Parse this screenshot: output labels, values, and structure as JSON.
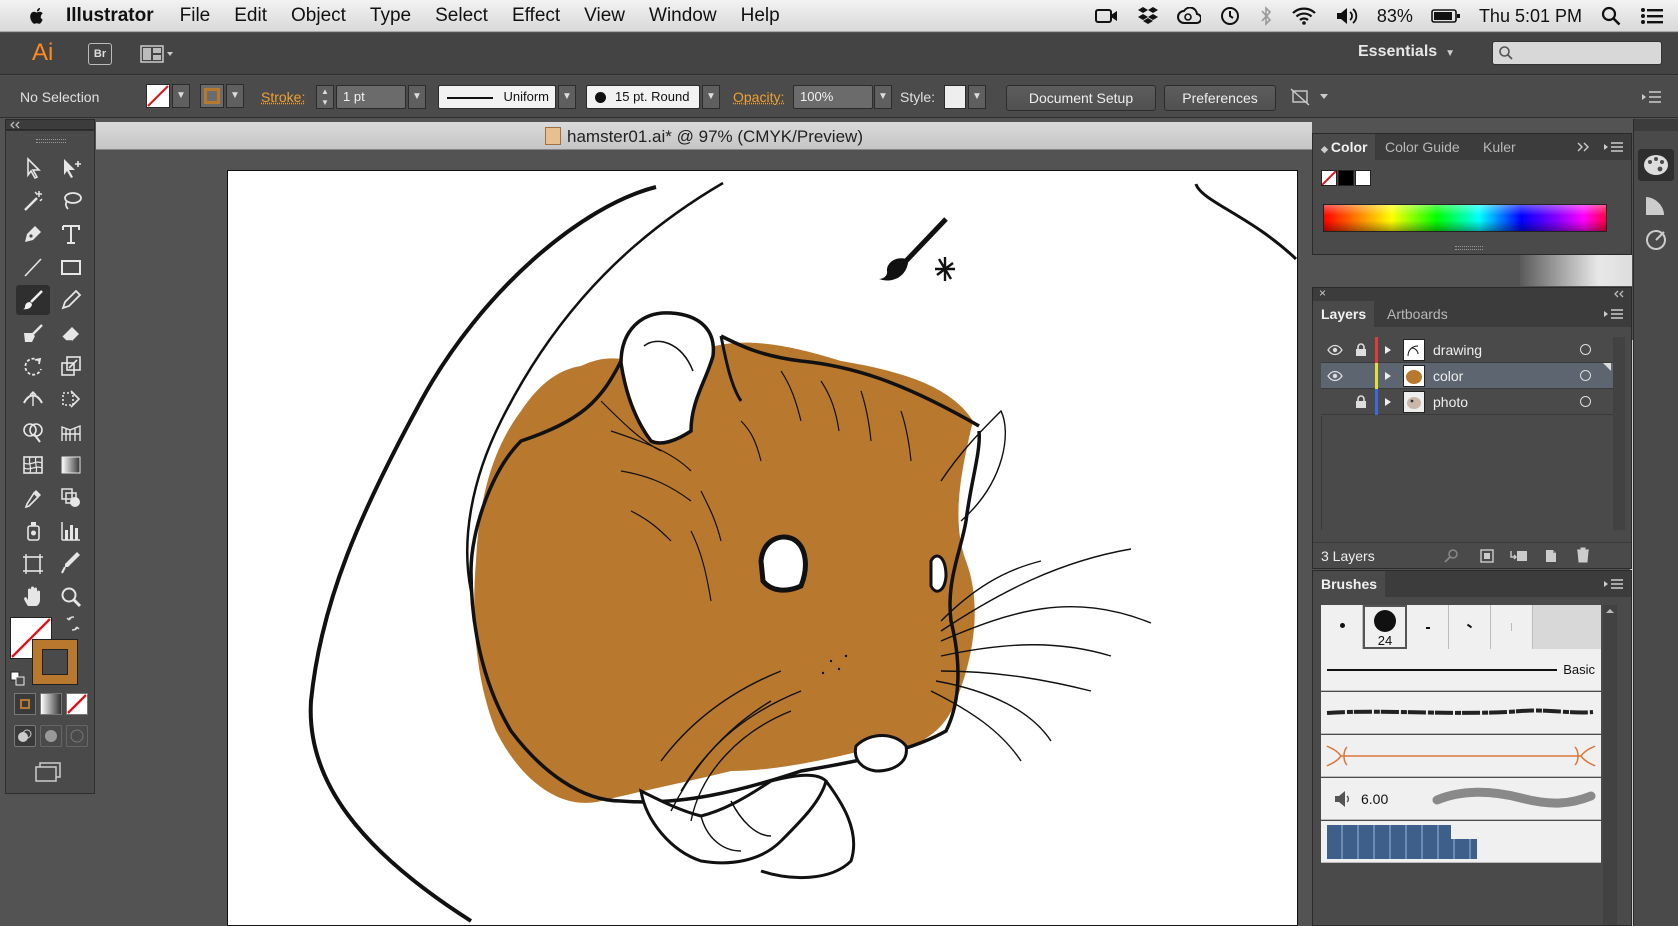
{
  "menubar": {
    "app": "Illustrator",
    "items": [
      "File",
      "Edit",
      "Object",
      "Type",
      "Select",
      "Effect",
      "View",
      "Window",
      "Help"
    ],
    "battery": "83%",
    "clock": "Thu 5:01 PM"
  },
  "appbar": {
    "logo": "Ai",
    "bridge": "Br",
    "workspace": "Essentials",
    "workspace_caret": "▼"
  },
  "controlbar": {
    "selection": "No Selection",
    "stroke_label": "Stroke:",
    "stroke_value": "1 pt",
    "profile": "Uniform",
    "brush": "15 pt. Round",
    "opacity_label": "Opacity:",
    "opacity_value": "100%",
    "style_label": "Style:",
    "document_setup": "Document Setup",
    "preferences": "Preferences",
    "drop": "▼"
  },
  "document": {
    "title": "hamster01.ai* @ 97% (CMYK/Preview)"
  },
  "color_panel": {
    "tabs": [
      "Color",
      "Color Guide",
      "Kuler"
    ]
  },
  "layers_panel": {
    "tabs": [
      "Layers",
      "Artboards"
    ],
    "layers": [
      {
        "name": "drawing",
        "color": "#e03a3a",
        "visible": true,
        "locked": true,
        "selected": false
      },
      {
        "name": "color",
        "color": "#e8e030",
        "visible": true,
        "locked": false,
        "selected": true
      },
      {
        "name": "photo",
        "color": "#3a6ae0",
        "visible": false,
        "locked": true,
        "selected": false
      }
    ],
    "count": "3 Layers"
  },
  "brushes_panel": {
    "title": "Brushes",
    "selected_size": "24",
    "basic_label": "Basic",
    "size_value": "6.00"
  },
  "colors": {
    "fill_orange": "#b8792f",
    "ui_dark": "#4a4a4a",
    "accent_link": "#f0a030"
  }
}
